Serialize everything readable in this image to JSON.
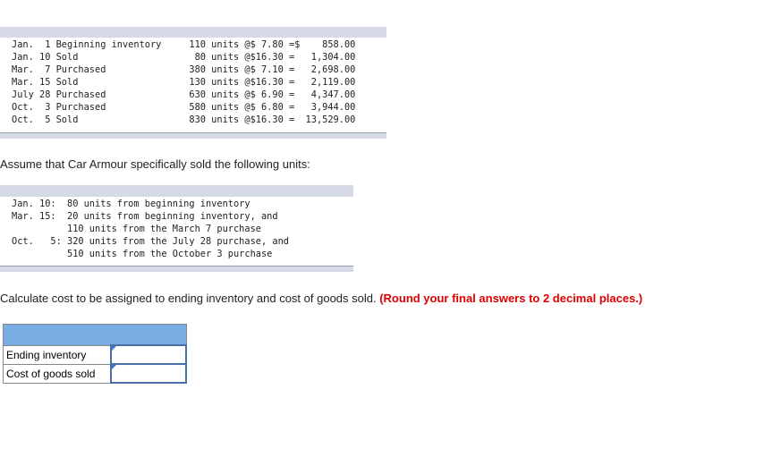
{
  "transactions": [
    "Jan.  1 Beginning inventory     110 units @$ 7.80 =$    858.00",
    "Jan. 10 Sold                     80 units @$16.30 =   1,304.00",
    "Mar.  7 Purchased               380 units @$ 7.10 =   2,698.00",
    "Mar. 15 Sold                    130 units @$16.30 =   2,119.00",
    "July 28 Purchased               630 units @$ 6.90 =   4,347.00",
    "Oct.  3 Purchased               580 units @$ 6.80 =   3,944.00",
    "Oct.  5 Sold                    830 units @$16.30 =  13,529.00"
  ],
  "assume_text": "Assume that Car Armour specifically sold the following units:",
  "specific_units": [
    "Jan. 10:  80 units from beginning inventory",
    "Mar. 15:  20 units from beginning inventory, and",
    "          110 units from the March 7 purchase",
    "Oct.   5: 320 units from the July 28 purchase, and",
    "          510 units from the October 3 purchase"
  ],
  "instruction": "Calculate cost to be assigned to ending inventory and cost of goods sold. ",
  "instruction_note": "(Round your final answers to 2 decimal places.)",
  "answer_table": {
    "rows": [
      {
        "label": "Ending inventory",
        "value": ""
      },
      {
        "label": "Cost of goods sold",
        "value": ""
      }
    ]
  }
}
